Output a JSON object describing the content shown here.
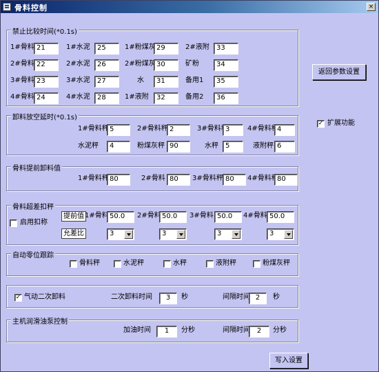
{
  "window": {
    "title": "骨料控制",
    "close_label": "×"
  },
  "forbid_compare": {
    "title": "禁止比较时间(*0.1s)",
    "rows": [
      [
        {
          "label": "1#骨料",
          "value": "21"
        },
        {
          "label": "1#水泥",
          "value": "25"
        },
        {
          "label": "1#粉煤灰",
          "value": "29"
        },
        {
          "label": "2#液附",
          "value": "33"
        }
      ],
      [
        {
          "label": "2#骨料",
          "value": "22"
        },
        {
          "label": "2#水泥",
          "value": "26"
        },
        {
          "label": "2#粉煤灰",
          "value": "30"
        },
        {
          "label": "矿粉",
          "value": "34"
        }
      ],
      [
        {
          "label": "3#骨料",
          "value": "23"
        },
        {
          "label": "3#水泥",
          "value": "27"
        },
        {
          "label": "水",
          "value": "31"
        },
        {
          "label": "备用1",
          "value": "35"
        }
      ],
      [
        {
          "label": "4#骨料",
          "value": "24"
        },
        {
          "label": "4#水泥",
          "value": "28"
        },
        {
          "label": "1#液附",
          "value": "32"
        },
        {
          "label": "备用2",
          "value": "36"
        }
      ]
    ]
  },
  "return_params_button": "返回参数设置",
  "extend": {
    "label": "扩展功能",
    "checked": "✓"
  },
  "unload_delay": {
    "title": "卸料放空延时(*0.1s)",
    "rows": [
      [
        {
          "label": "1#骨料秤",
          "value": "5"
        },
        {
          "label": "2#骨料秤",
          "value": "2"
        },
        {
          "label": "3#骨料秤",
          "value": "3"
        },
        {
          "label": "4#骨料秤",
          "value": "4"
        }
      ],
      [
        {
          "label": "水泥秤",
          "value": "4"
        },
        {
          "label": "粉煤灰秤",
          "value": "90"
        },
        {
          "label": "水秤",
          "value": "5"
        },
        {
          "label": "液附秤",
          "value": "6"
        }
      ]
    ]
  },
  "advance_unload": {
    "title": "骨料提前卸料值",
    "items": [
      {
        "label": "1#骨料秤",
        "value": "80"
      },
      {
        "label": "2#骨料",
        "value": "80"
      },
      {
        "label": "3#骨料秤",
        "value": "80"
      },
      {
        "label": "4#骨料秤",
        "value": "80"
      }
    ]
  },
  "overweight": {
    "title": "骨料超差扣秤",
    "enable_label": "启用扣称",
    "advance_label": "提前值",
    "ratio_label": "允差比",
    "items": [
      {
        "label": "1#骨料",
        "value": "50.0",
        "ratio": "3"
      },
      {
        "label": "2#骨料",
        "value": "50.0",
        "ratio": "3"
      },
      {
        "label": "3#骨料",
        "value": "50.0",
        "ratio": "3"
      },
      {
        "label": "4#骨料",
        "value": "50.0",
        "ratio": "3"
      }
    ]
  },
  "auto_zero": {
    "title": "自动零位跟踪",
    "items": [
      "骨料秤",
      "水泥秤",
      "水秤",
      "液附秤",
      "粉煤灰秤"
    ]
  },
  "pneumatic": {
    "label": "气动二次卸料",
    "checked": "✓",
    "second_time_label": "二次卸料时间",
    "second_time_value": "3",
    "second_time_unit": "秒",
    "interval_label": "间隔时间",
    "interval_value": "2",
    "interval_unit": "秒"
  },
  "lube": {
    "title": "主机润滑油泵控制",
    "add_time_label": "加油时间",
    "add_time_value": "1",
    "add_time_unit": "分秒",
    "interval_label": "间隔时间",
    "interval_value": "2",
    "interval_unit": "分秒"
  },
  "write_button": "写入设置"
}
